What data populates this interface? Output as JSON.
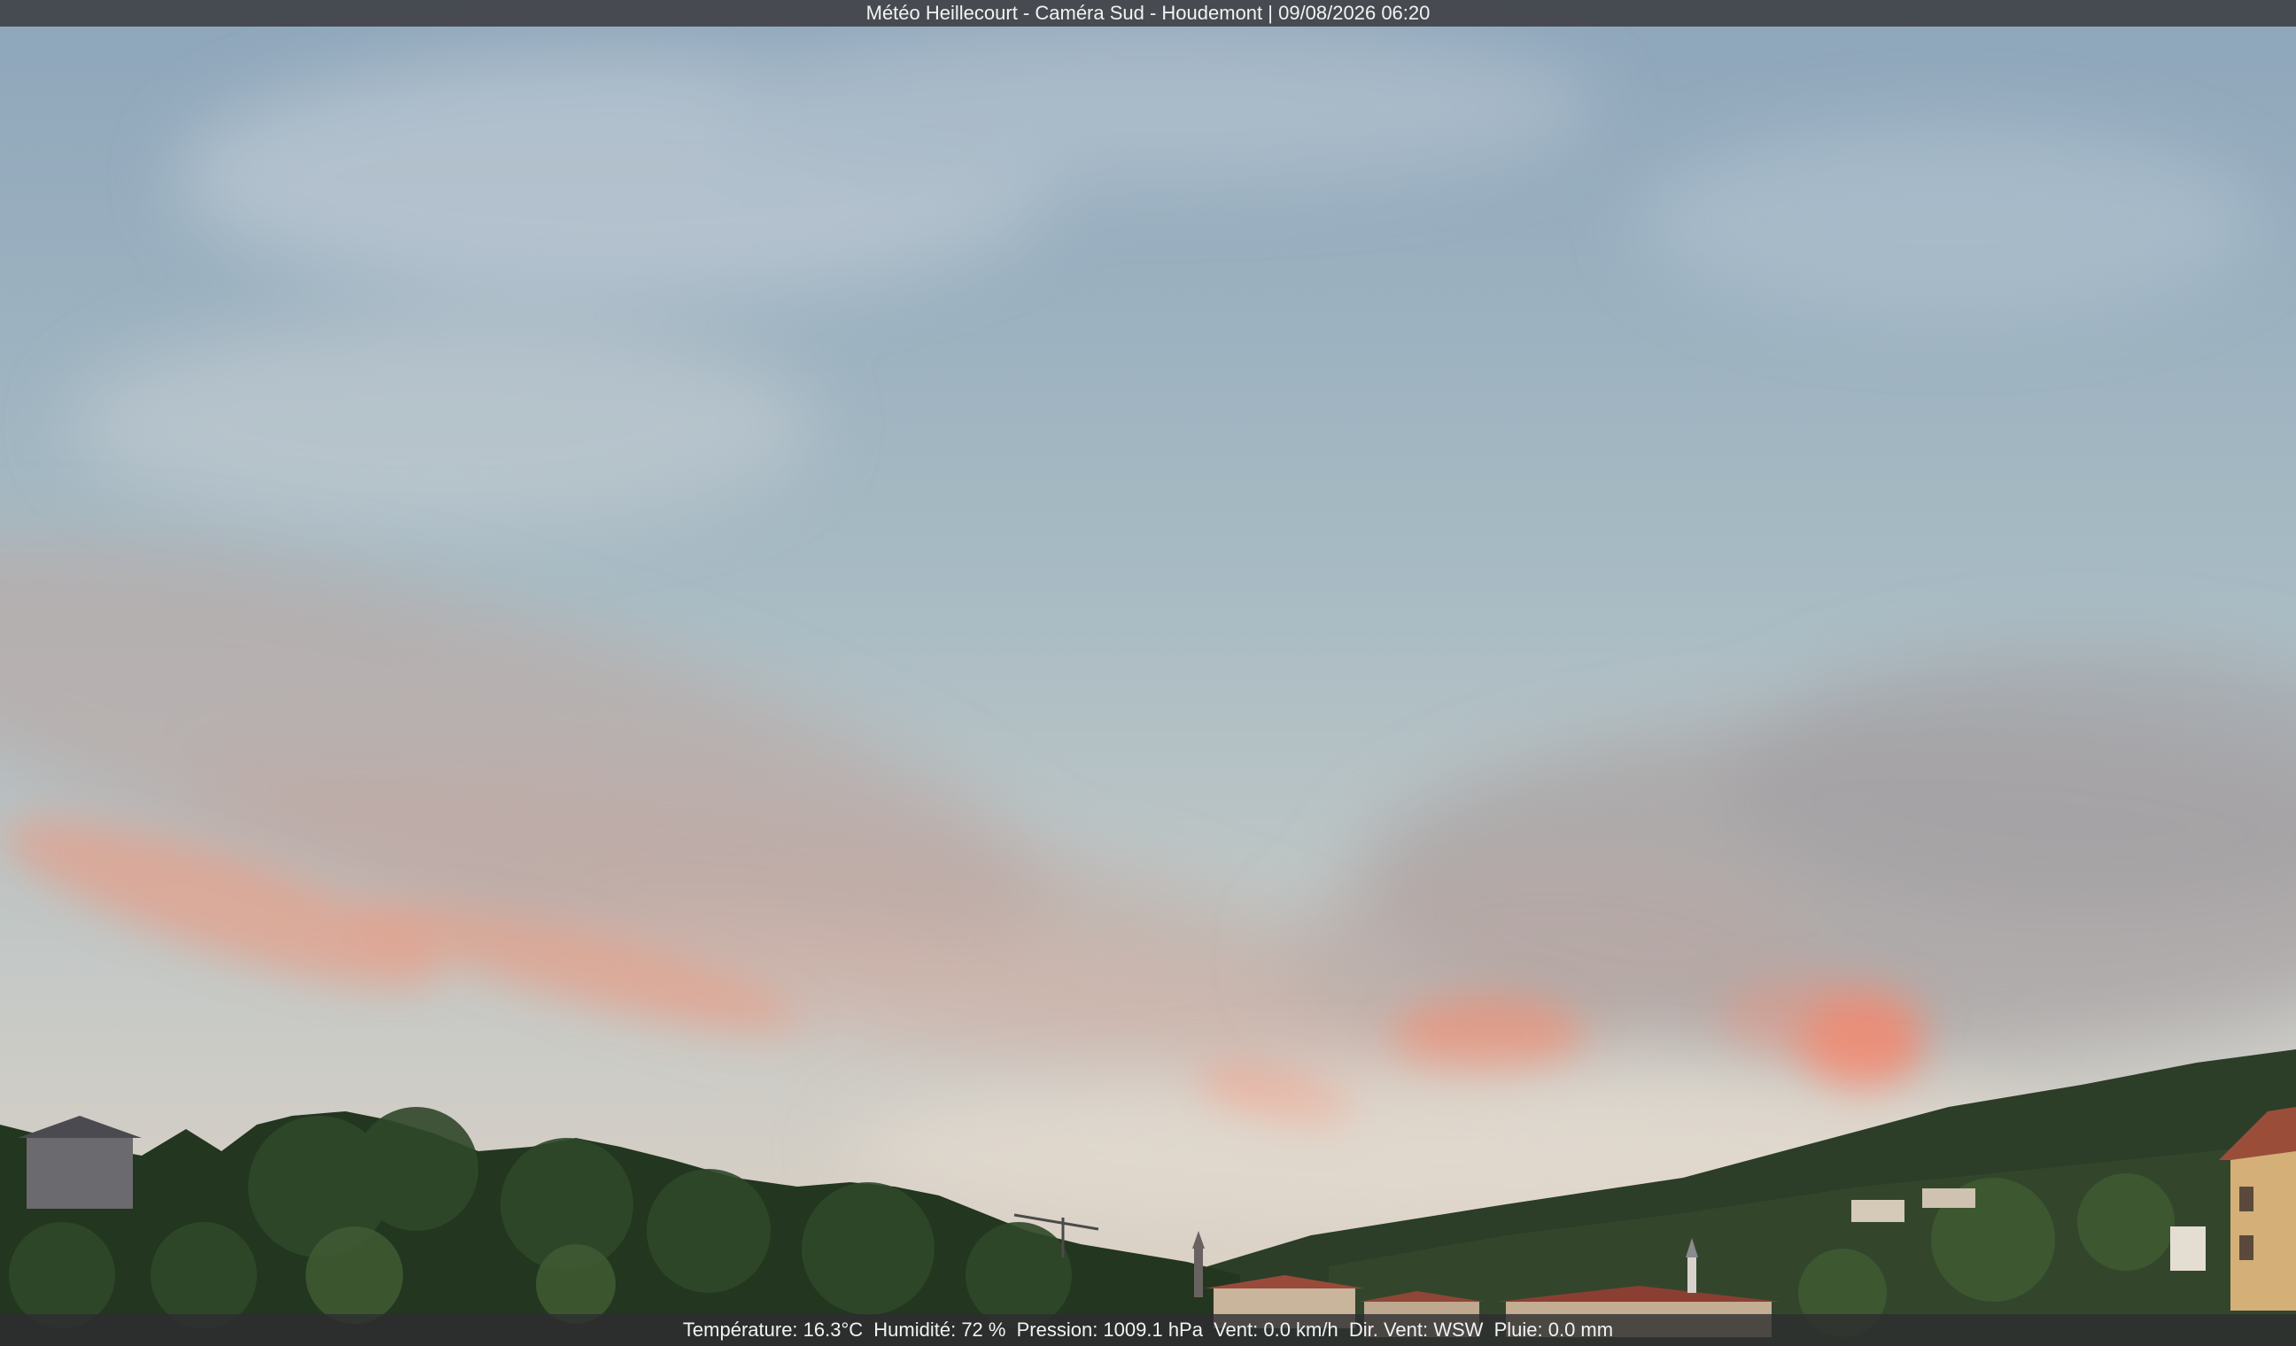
{
  "caption": "Météo Heillecourt - Caméra Sud - Houdemont | 09/08/2026 06:20",
  "readings": {
    "temperature": "Température: 16.3°C",
    "humidity": "Humidité: 72 %",
    "pressure": "Pression: 1009.1 hPa",
    "wind": "Vent: 0.0 km/h",
    "wind_dir": "Dir. Vent: WSW",
    "rain": "Pluie: 0.0 mm"
  },
  "colors": {
    "sky_top": "#8ea6bb",
    "sky_mid": "#a9bcc4",
    "sky_horizon": "#e0d2c4",
    "cloud_pink": "#f09478",
    "foliage": "#23361f"
  }
}
